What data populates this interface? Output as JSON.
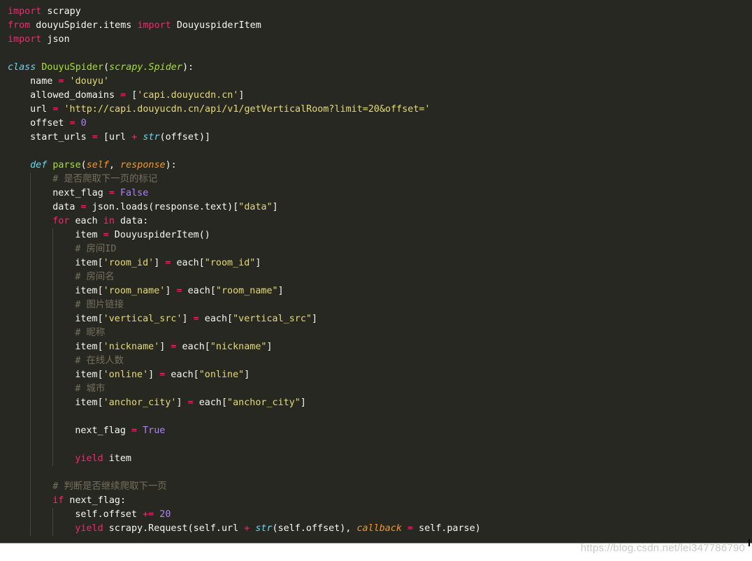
{
  "editor": {
    "colors": {
      "background": "#272822",
      "text": "#f8f8f2",
      "keyword": "#f92672",
      "storage": "#66d9ef",
      "class_name": "#a6e22e",
      "string": "#e6db74",
      "number": "#ae81ff",
      "comment": "#75715e",
      "parameter": "#fd971f"
    },
    "lines": [
      {
        "indent": 0,
        "tokens": [
          {
            "t": "kw",
            "v": "import"
          },
          {
            "t": "",
            "v": " scrapy"
          }
        ]
      },
      {
        "indent": 0,
        "tokens": [
          {
            "t": "kw",
            "v": "from"
          },
          {
            "t": "",
            "v": " douyuSpider.items "
          },
          {
            "t": "kw",
            "v": "import"
          },
          {
            "t": "",
            "v": " DouyuspiderItem"
          }
        ]
      },
      {
        "indent": 0,
        "tokens": [
          {
            "t": "kw",
            "v": "import"
          },
          {
            "t": "",
            "v": " json"
          }
        ]
      },
      {
        "indent": 0,
        "tokens": []
      },
      {
        "indent": 0,
        "tokens": [
          {
            "t": "def",
            "v": "class"
          },
          {
            "t": "",
            "v": " "
          },
          {
            "t": "cls",
            "v": "DouyuSpider"
          },
          {
            "t": "",
            "v": "("
          },
          {
            "t": "inh",
            "v": "scrapy.Spider"
          },
          {
            "t": "",
            "v": "):"
          }
        ]
      },
      {
        "indent": 1,
        "tokens": [
          {
            "t": "",
            "v": "name "
          },
          {
            "t": "op",
            "v": "="
          },
          {
            "t": "",
            "v": " "
          },
          {
            "t": "str",
            "v": "'douyu'"
          }
        ]
      },
      {
        "indent": 1,
        "tokens": [
          {
            "t": "",
            "v": "allowed_domains "
          },
          {
            "t": "op",
            "v": "="
          },
          {
            "t": "",
            "v": " ["
          },
          {
            "t": "str",
            "v": "'capi.douyucdn.cn'"
          },
          {
            "t": "",
            "v": "]"
          }
        ]
      },
      {
        "indent": 1,
        "tokens": [
          {
            "t": "",
            "v": "url "
          },
          {
            "t": "op",
            "v": "="
          },
          {
            "t": "",
            "v": " "
          },
          {
            "t": "str",
            "v": "'http://capi.douyucdn.cn/api/v1/getVerticalRoom?limit=20&offset='"
          }
        ]
      },
      {
        "indent": 1,
        "tokens": [
          {
            "t": "",
            "v": "offset "
          },
          {
            "t": "op",
            "v": "="
          },
          {
            "t": "",
            "v": " "
          },
          {
            "t": "num",
            "v": "0"
          }
        ]
      },
      {
        "indent": 1,
        "tokens": [
          {
            "t": "",
            "v": "start_urls "
          },
          {
            "t": "op",
            "v": "="
          },
          {
            "t": "",
            "v": " [url "
          },
          {
            "t": "op",
            "v": "+"
          },
          {
            "t": "",
            "v": " "
          },
          {
            "t": "bi",
            "v": "str"
          },
          {
            "t": "",
            "v": "(offset)]"
          }
        ]
      },
      {
        "indent": 1,
        "tokens": []
      },
      {
        "indent": 1,
        "tokens": [
          {
            "t": "def",
            "v": "def"
          },
          {
            "t": "",
            "v": " "
          },
          {
            "t": "fn",
            "v": "parse"
          },
          {
            "t": "",
            "v": "("
          },
          {
            "t": "par",
            "v": "self"
          },
          {
            "t": "",
            "v": ", "
          },
          {
            "t": "par",
            "v": "response"
          },
          {
            "t": "",
            "v": "):"
          }
        ]
      },
      {
        "indent": 2,
        "tokens": [
          {
            "t": "cmt",
            "v": "# 是否爬取下一页的标记"
          }
        ]
      },
      {
        "indent": 2,
        "tokens": [
          {
            "t": "",
            "v": "next_flag "
          },
          {
            "t": "op",
            "v": "="
          },
          {
            "t": "",
            "v": " "
          },
          {
            "t": "num",
            "v": "False"
          }
        ]
      },
      {
        "indent": 2,
        "tokens": [
          {
            "t": "",
            "v": "data "
          },
          {
            "t": "op",
            "v": "="
          },
          {
            "t": "",
            "v": " json.loads(response.text)["
          },
          {
            "t": "str",
            "v": "\"data\""
          },
          {
            "t": "",
            "v": "]"
          }
        ]
      },
      {
        "indent": 2,
        "tokens": [
          {
            "t": "kw",
            "v": "for"
          },
          {
            "t": "",
            "v": " each "
          },
          {
            "t": "kw",
            "v": "in"
          },
          {
            "t": "",
            "v": " data:"
          }
        ]
      },
      {
        "indent": 3,
        "tokens": [
          {
            "t": "",
            "v": "item "
          },
          {
            "t": "op",
            "v": "="
          },
          {
            "t": "",
            "v": " DouyuspiderItem()"
          }
        ]
      },
      {
        "indent": 3,
        "tokens": [
          {
            "t": "cmt",
            "v": "# 房间ID"
          }
        ]
      },
      {
        "indent": 3,
        "tokens": [
          {
            "t": "",
            "v": "item["
          },
          {
            "t": "str",
            "v": "'room_id'"
          },
          {
            "t": "",
            "v": "] "
          },
          {
            "t": "op",
            "v": "="
          },
          {
            "t": "",
            "v": " each["
          },
          {
            "t": "str",
            "v": "\"room_id\""
          },
          {
            "t": "",
            "v": "]"
          }
        ]
      },
      {
        "indent": 3,
        "tokens": [
          {
            "t": "cmt",
            "v": "# 房间名"
          }
        ]
      },
      {
        "indent": 3,
        "tokens": [
          {
            "t": "",
            "v": "item["
          },
          {
            "t": "str",
            "v": "'room_name'"
          },
          {
            "t": "",
            "v": "] "
          },
          {
            "t": "op",
            "v": "="
          },
          {
            "t": "",
            "v": " each["
          },
          {
            "t": "str",
            "v": "\"room_name\""
          },
          {
            "t": "",
            "v": "]"
          }
        ]
      },
      {
        "indent": 3,
        "tokens": [
          {
            "t": "cmt",
            "v": "# 图片链接"
          }
        ]
      },
      {
        "indent": 3,
        "tokens": [
          {
            "t": "",
            "v": "item["
          },
          {
            "t": "str",
            "v": "'vertical_src'"
          },
          {
            "t": "",
            "v": "] "
          },
          {
            "t": "op",
            "v": "="
          },
          {
            "t": "",
            "v": " each["
          },
          {
            "t": "str",
            "v": "\"vertical_src\""
          },
          {
            "t": "",
            "v": "]"
          }
        ]
      },
      {
        "indent": 3,
        "tokens": [
          {
            "t": "cmt",
            "v": "# 昵称"
          }
        ]
      },
      {
        "indent": 3,
        "tokens": [
          {
            "t": "",
            "v": "item["
          },
          {
            "t": "str",
            "v": "'nickname'"
          },
          {
            "t": "",
            "v": "] "
          },
          {
            "t": "op",
            "v": "="
          },
          {
            "t": "",
            "v": " each["
          },
          {
            "t": "str",
            "v": "\"nickname\""
          },
          {
            "t": "",
            "v": "]"
          }
        ]
      },
      {
        "indent": 3,
        "tokens": [
          {
            "t": "cmt",
            "v": "# 在线人数"
          }
        ]
      },
      {
        "indent": 3,
        "tokens": [
          {
            "t": "",
            "v": "item["
          },
          {
            "t": "str",
            "v": "'online'"
          },
          {
            "t": "",
            "v": "] "
          },
          {
            "t": "op",
            "v": "="
          },
          {
            "t": "",
            "v": " each["
          },
          {
            "t": "str",
            "v": "\"online\""
          },
          {
            "t": "",
            "v": "]"
          }
        ]
      },
      {
        "indent": 3,
        "tokens": [
          {
            "t": "cmt",
            "v": "# 城市"
          }
        ]
      },
      {
        "indent": 3,
        "tokens": [
          {
            "t": "",
            "v": "item["
          },
          {
            "t": "str",
            "v": "'anchor_city'"
          },
          {
            "t": "",
            "v": "] "
          },
          {
            "t": "op",
            "v": "="
          },
          {
            "t": "",
            "v": " each["
          },
          {
            "t": "str",
            "v": "\"anchor_city\""
          },
          {
            "t": "",
            "v": "]"
          }
        ]
      },
      {
        "indent": 3,
        "tokens": []
      },
      {
        "indent": 3,
        "tokens": [
          {
            "t": "",
            "v": "next_flag "
          },
          {
            "t": "op",
            "v": "="
          },
          {
            "t": "",
            "v": " "
          },
          {
            "t": "num",
            "v": "True"
          }
        ]
      },
      {
        "indent": 3,
        "tokens": []
      },
      {
        "indent": 3,
        "tokens": [
          {
            "t": "kw",
            "v": "yield"
          },
          {
            "t": "",
            "v": " item"
          }
        ]
      },
      {
        "indent": 2,
        "tokens": []
      },
      {
        "indent": 2,
        "tokens": [
          {
            "t": "cmt",
            "v": "# 判断是否继续爬取下一页"
          }
        ]
      },
      {
        "indent": 2,
        "tokens": [
          {
            "t": "kw",
            "v": "if"
          },
          {
            "t": "",
            "v": " next_flag:"
          }
        ]
      },
      {
        "indent": 3,
        "tokens": [
          {
            "t": "",
            "v": "self.offset "
          },
          {
            "t": "op",
            "v": "+="
          },
          {
            "t": "",
            "v": " "
          },
          {
            "t": "num",
            "v": "20"
          }
        ]
      },
      {
        "indent": 3,
        "tokens": [
          {
            "t": "kw",
            "v": "yield"
          },
          {
            "t": "",
            "v": " scrapy.Request(self.url "
          },
          {
            "t": "op",
            "v": "+"
          },
          {
            "t": "",
            "v": " "
          },
          {
            "t": "bi",
            "v": "str"
          },
          {
            "t": "",
            "v": "(self.offset), "
          },
          {
            "t": "par",
            "v": "callback"
          },
          {
            "t": "",
            "v": " "
          },
          {
            "t": "op",
            "v": "="
          },
          {
            "t": "",
            "v": " self.parse)"
          }
        ]
      }
    ]
  },
  "watermark": "https://blog.csdn.net/lei347786790"
}
